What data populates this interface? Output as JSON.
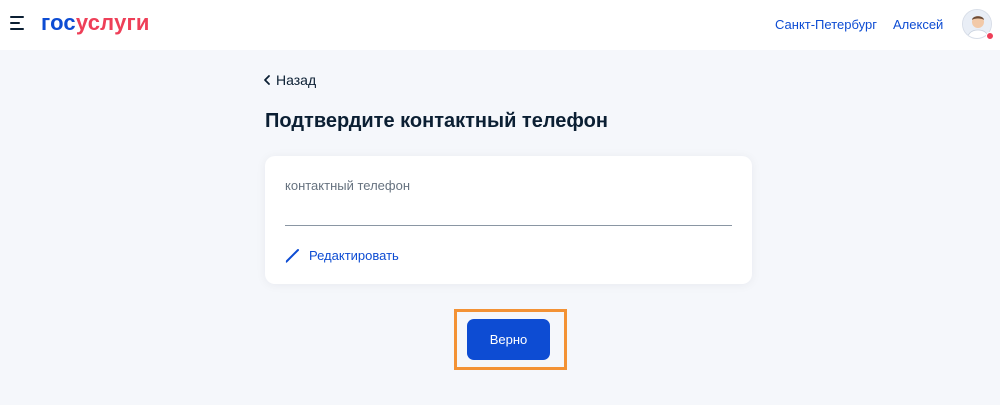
{
  "header": {
    "logo_part1": "гос",
    "logo_part2": "услуги",
    "city": "Санкт-Петербург",
    "user_name": "Алексей"
  },
  "nav": {
    "back_label": "Назад"
  },
  "page": {
    "title": "Подтвердите контактный телефон"
  },
  "form": {
    "field_label": "контактный телефон",
    "field_value": "",
    "edit_label": "Редактировать"
  },
  "actions": {
    "confirm_label": "Верно"
  },
  "colors": {
    "brand_blue": "#0d4cd3",
    "brand_red": "#ee3f58",
    "highlight_orange": "#f39235"
  }
}
